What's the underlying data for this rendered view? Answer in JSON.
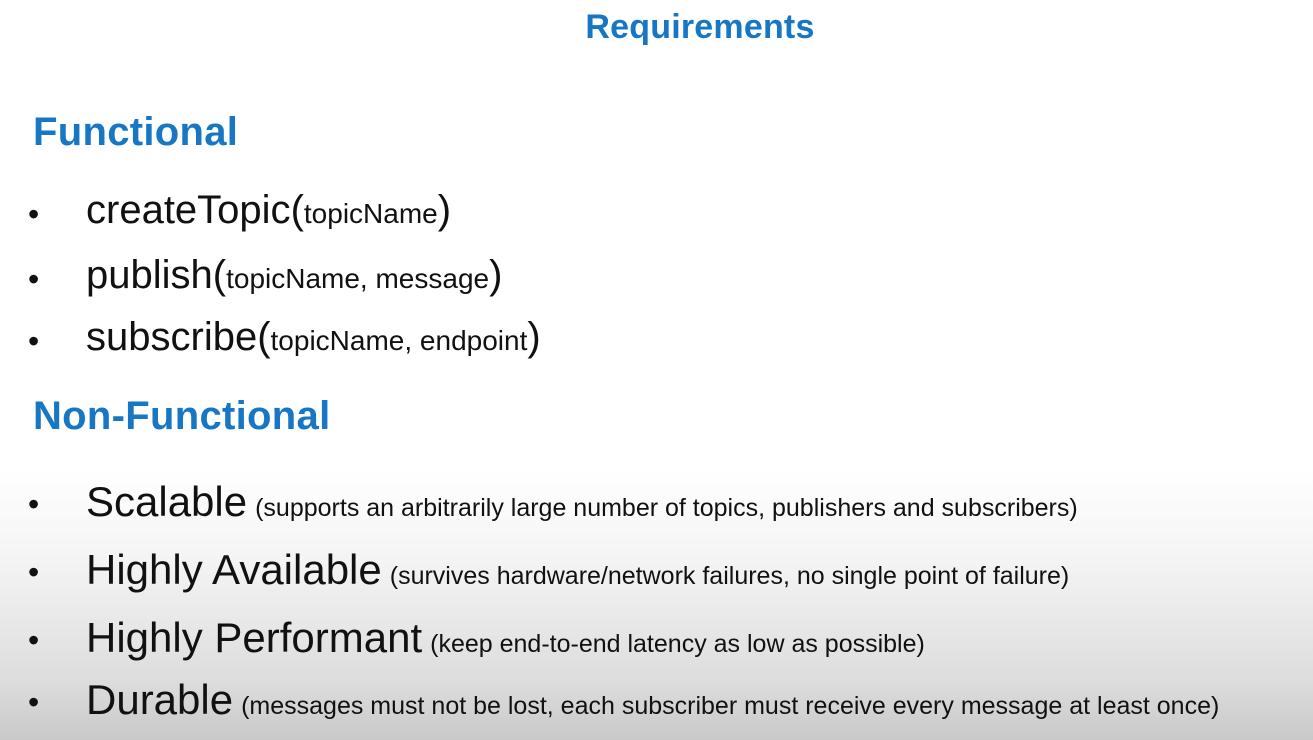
{
  "title": "Requirements",
  "functional": {
    "heading": "Functional",
    "items": [
      {
        "name": "createTopic",
        "open": "(",
        "args": "topicName",
        "close": ")"
      },
      {
        "name": "publish",
        "open": "(",
        "args": "topicName, message",
        "close": ")"
      },
      {
        "name": "subscribe",
        "open": "(",
        "args": "topicName, endpoint",
        "close": ")"
      }
    ]
  },
  "non_functional": {
    "heading": "Non-Functional",
    "items": [
      {
        "name": "Scalable",
        "desc": "(supports an arbitrarily large number of topics, publishers and subscribers)"
      },
      {
        "name": "Highly Available",
        "desc": "(survives hardware/network failures, no single point of failure)"
      },
      {
        "name": "Highly Performant",
        "desc": "(keep end-to-end latency as low as possible)"
      },
      {
        "name": "Durable",
        "desc": "(messages must not be lost, each subscriber must receive every message at least once)"
      }
    ]
  },
  "bullet_glyph": "•",
  "colors": {
    "heading": "#1777c4",
    "text": "#111111"
  }
}
